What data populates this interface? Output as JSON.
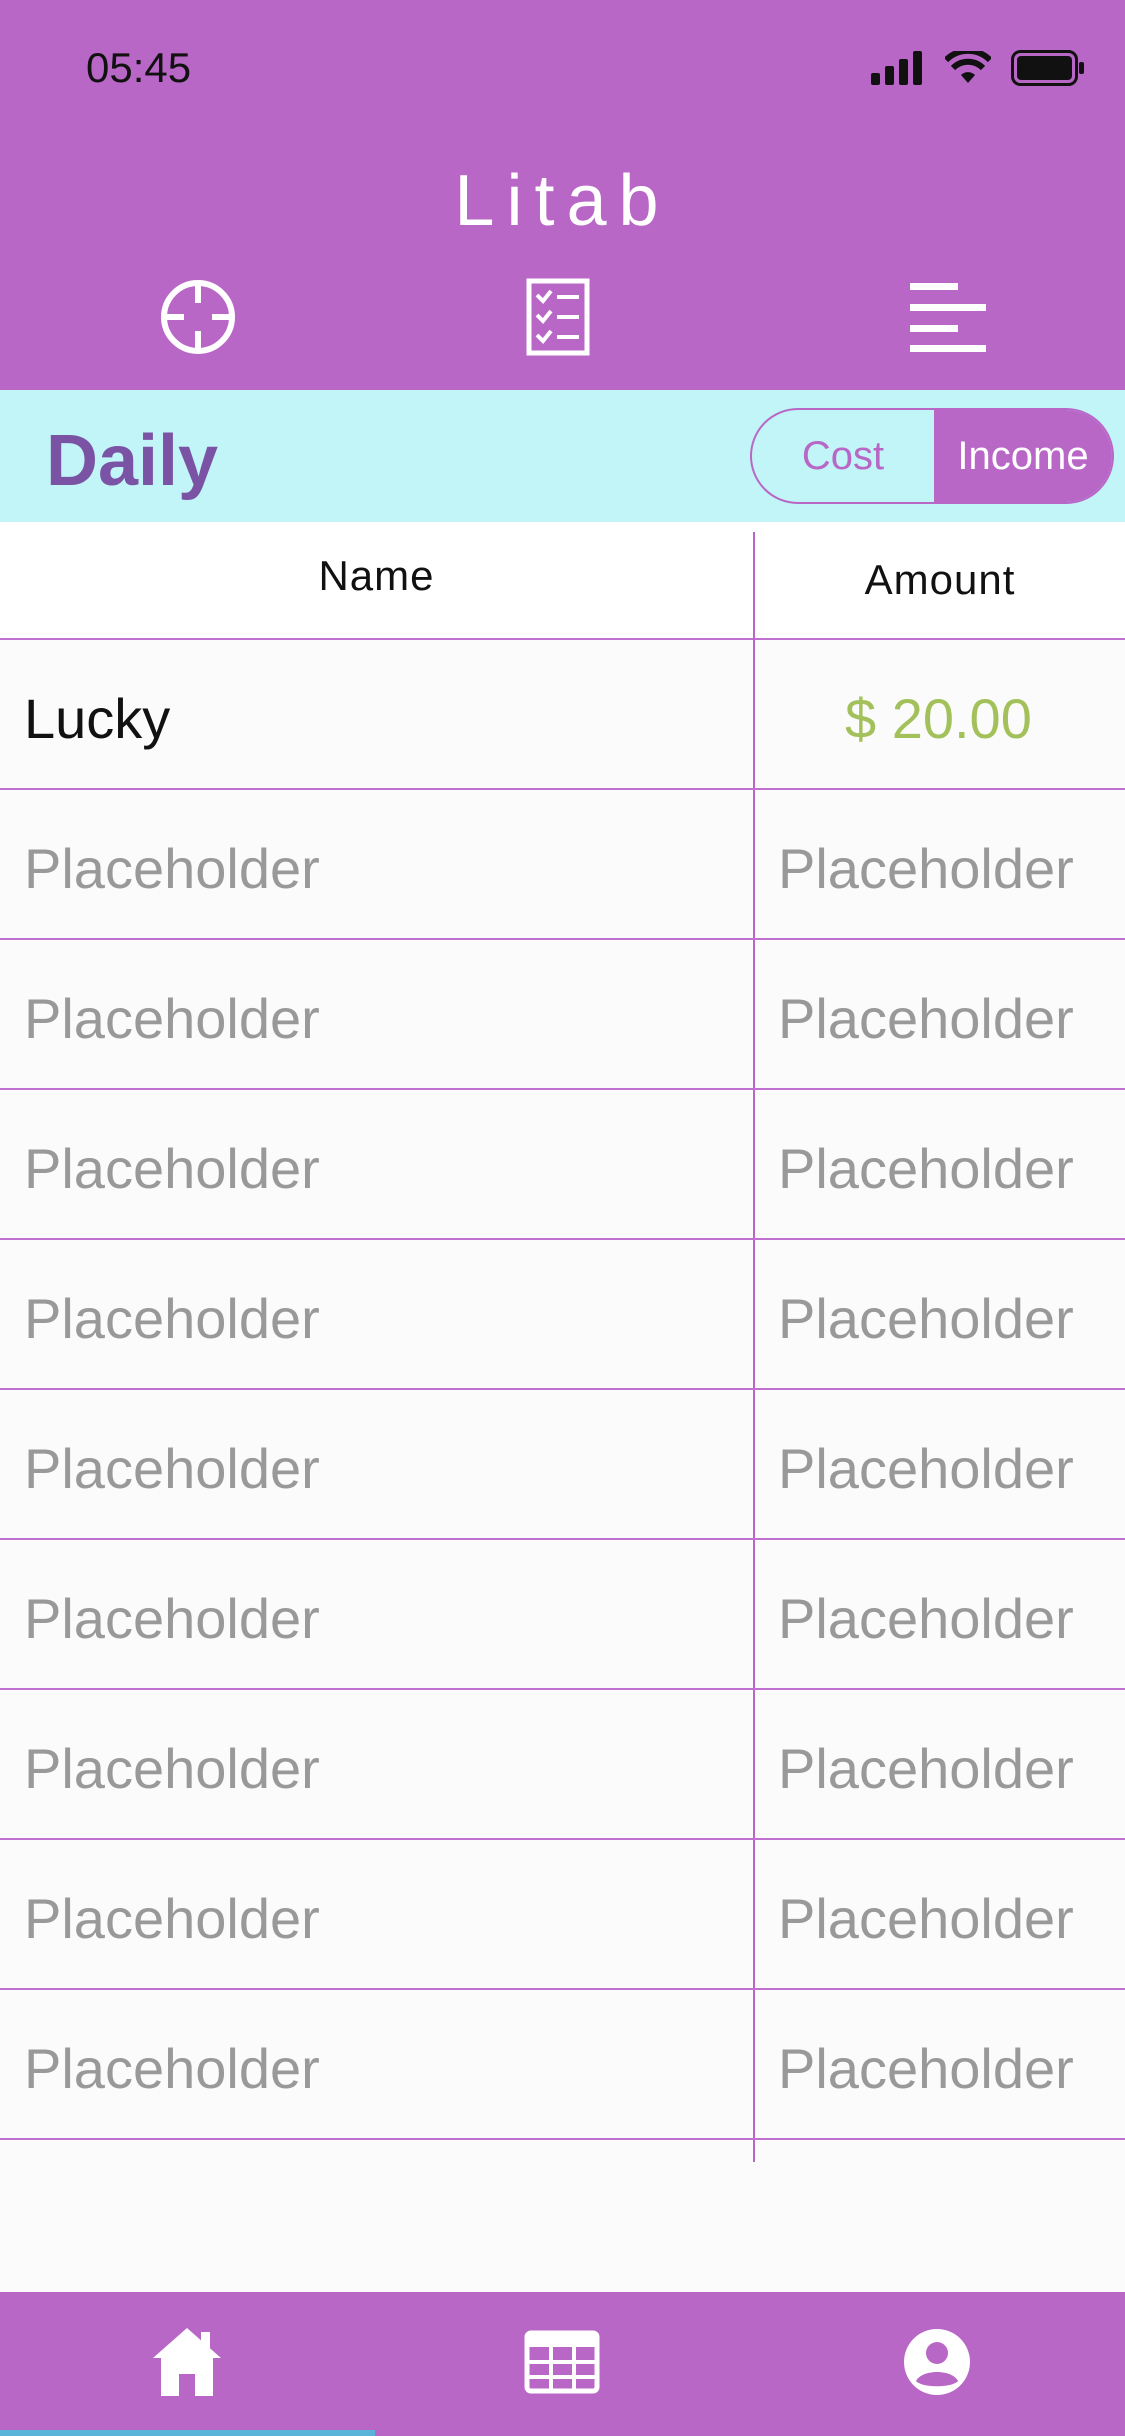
{
  "status": {
    "time": "05:45"
  },
  "header": {
    "title": "Litab"
  },
  "toolbar": {
    "icons": [
      "crosshair-icon",
      "checklist-icon",
      "menu-lines-icon"
    ]
  },
  "section": {
    "title": "Daily",
    "toggle": {
      "options": [
        "Cost",
        "Income"
      ],
      "selected": "Income"
    }
  },
  "table": {
    "columns": [
      "Name",
      "Amount"
    ],
    "rows": [
      {
        "name": "Lucky",
        "amount": "$ 20.00"
      },
      {
        "name": "Placeholder",
        "amount": "Placeholder"
      },
      {
        "name": "Placeholder",
        "amount": "Placeholder"
      },
      {
        "name": "Placeholder",
        "amount": "Placeholder"
      },
      {
        "name": "Placeholder",
        "amount": "Placeholder"
      },
      {
        "name": "Placeholder",
        "amount": "Placeholder"
      },
      {
        "name": "Placeholder",
        "amount": "Placeholder"
      },
      {
        "name": "Placeholder",
        "amount": "Placeholder"
      },
      {
        "name": "Placeholder",
        "amount": "Placeholder"
      },
      {
        "name": "Placeholder",
        "amount": "Placeholder"
      }
    ]
  },
  "tabbar": {
    "items": [
      "home-icon",
      "table-icon",
      "profile-icon"
    ],
    "active": "home-icon"
  },
  "colors": {
    "brand": "#b967c7",
    "accent_bar": "#c2f5f7",
    "income": "#a3c15b",
    "title": "#7b53a4"
  }
}
